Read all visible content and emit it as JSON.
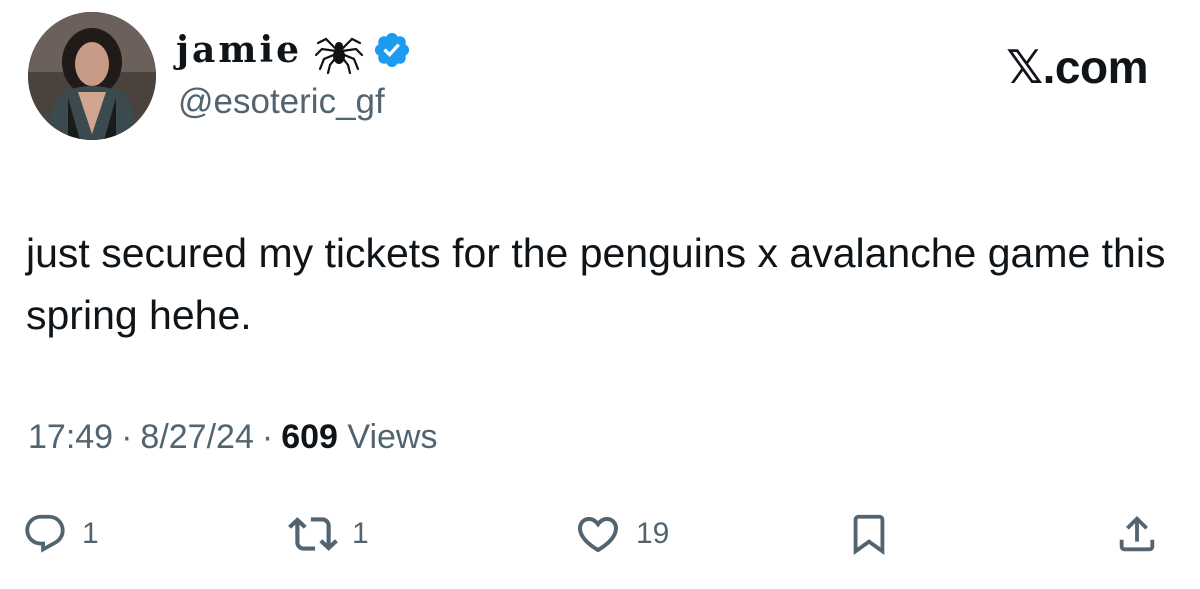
{
  "author": {
    "display_name": "jamie",
    "handle": "@esoteric_gf",
    "name_emoji_icon": "spider-icon",
    "verified_icon": "verified-badge-icon",
    "verified_color": "#1d9bf0"
  },
  "brand": "𝕏.com",
  "tweet": {
    "text": "just secured my tickets for the penguins x avalanche game this spring hehe."
  },
  "meta": {
    "time": "17:49",
    "date": "8/27/24",
    "separator": "·",
    "views_count": "609",
    "views_label": "Views"
  },
  "actions": {
    "reply": {
      "icon": "reply-icon",
      "count": "1"
    },
    "repost": {
      "icon": "repost-icon",
      "count": "1"
    },
    "like": {
      "icon": "heart-icon",
      "count": "19"
    },
    "bookmark": {
      "icon": "bookmark-icon"
    },
    "share": {
      "icon": "share-icon"
    }
  },
  "colors": {
    "text_primary": "#0f1419",
    "text_secondary": "#536471",
    "background": "#ffffff"
  }
}
